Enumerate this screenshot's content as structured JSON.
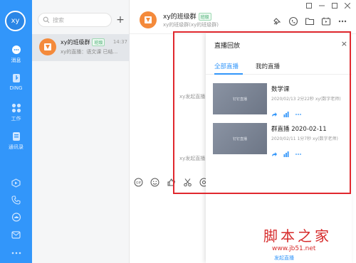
{
  "nav": {
    "avatar_text": "xy",
    "items": [
      {
        "icon": "chat-bubble-icon",
        "label": "消息"
      },
      {
        "icon": "ding-icon",
        "label": "DING"
      },
      {
        "icon": "apps-grid-icon",
        "label": "工作"
      },
      {
        "icon": "contacts-icon",
        "label": "通讯录"
      }
    ],
    "bottom_icons": [
      "play-icon",
      "phone-icon",
      "cloud-icon",
      "mail-icon",
      "more-icon"
    ]
  },
  "list": {
    "search_placeholder": "搜索",
    "add_label": "+",
    "conversation": {
      "name": "xy的班级群",
      "tag": "班级",
      "time": "14:37",
      "preview": "xy的直播：语文课 已结..."
    }
  },
  "chat": {
    "title": "xy的班级群",
    "tag": "班级",
    "subtitle": "xy的班级群(xy的班级群)",
    "system_messages": [
      "xy发起直播：语文课...",
      "xy发起直播：语文课..."
    ]
  },
  "panel": {
    "title": "直播回放",
    "close": "×",
    "tabs": [
      "全部直播",
      "我的直播"
    ],
    "records": [
      {
        "title": "数学课",
        "info": "2020/02/13 2分22秒 xy(数字老师)",
        "thumb_text": "钉钉直播"
      },
      {
        "title": "群直播 2020-02-11",
        "info": "2020/02/11 1分7秒 xy(数字老师)",
        "thumb_text": "钉钉直播"
      }
    ],
    "bottom_link": "发起直播"
  },
  "watermark": {
    "text": "脚本之家",
    "url": "www.jb51.net"
  },
  "colors": {
    "brand": "#3296fa",
    "highlight": "#e0282e"
  }
}
